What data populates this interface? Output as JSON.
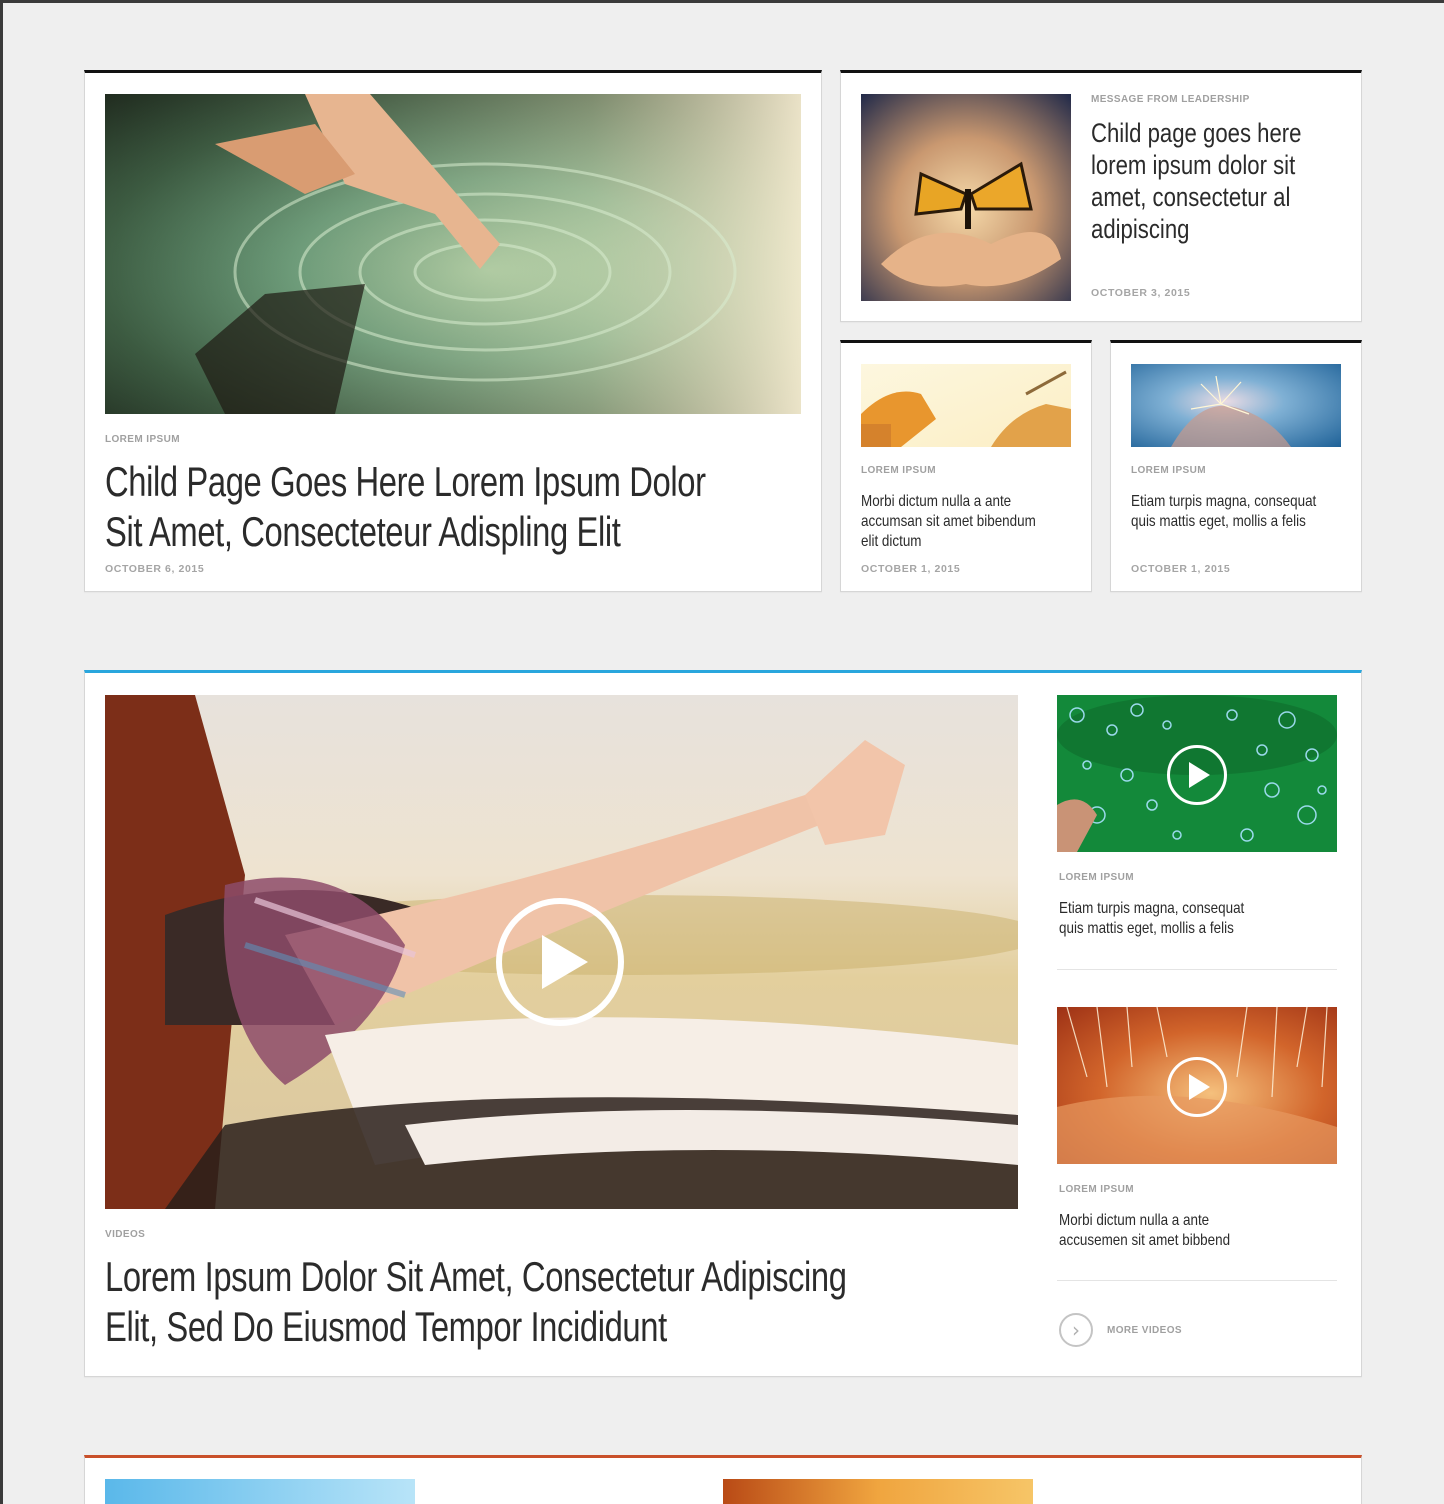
{
  "top_section": {
    "feature": {
      "kicker": "LOREM IPSUM",
      "title_line1": "Child Page Goes Here Lorem Ipsum Dolor",
      "title_line2": "Sit Amet, Consecteteur Adispling Elit",
      "date": "OCTOBER 6, 2015",
      "image": "hand-touching-water-photo"
    },
    "leadership": {
      "kicker": "MESSAGE FROM LEADERSHIP",
      "title_lines": [
        "Child page goes here",
        "lorem ipsum dolor sit",
        "amet, consectetur al",
        "adipiscing"
      ],
      "date": "OCTOBER 3, 2015",
      "image": "butterfly-in-hands-photo"
    },
    "small_cards": [
      {
        "kicker": "LOREM IPSUM",
        "title_lines": [
          "Morbi dictum nulla a ante",
          "accumsan sit amet bibendum",
          "elit dictum"
        ],
        "date": "OCTOBER 1, 2015",
        "image": "hands-with-pen-photo"
      },
      {
        "kicker": "LOREM IPSUM",
        "title_lines": [
          "Etiam turpis magna, consequat",
          "quis mattis eget, mollis a felis"
        ],
        "date": "OCTOBER 1, 2015",
        "image": "hands-with-sparkler-photo"
      }
    ]
  },
  "video_section": {
    "accent_color": "#29a6dd",
    "main": {
      "kicker": "VIDEOS",
      "title_line1": "Lorem Ipsum Dolor Sit Amet, Consectetur Adipiscing",
      "title_line2": "Elit, Sed Do Eiusmod Tempor Incididunt",
      "image": "arm-out-car-window-photo"
    },
    "side": [
      {
        "kicker": "LOREM IPSUM",
        "title_lines": [
          "Etiam turpis magna, consequat",
          "quis mattis eget, mollis a felis"
        ],
        "image": "bubbles-on-green-photo"
      },
      {
        "kicker": "LOREM IPSUM",
        "title_lines": [
          "Morbi dictum nulla a ante",
          "accusemen sit amet bibbend"
        ],
        "image": "fiber-optic-hand-photo"
      }
    ],
    "more_label": "MORE VIDEOS",
    "more_icon": "chevron-right-circle-icon"
  },
  "bottom_section": {
    "accent_color": "#c9502a"
  }
}
